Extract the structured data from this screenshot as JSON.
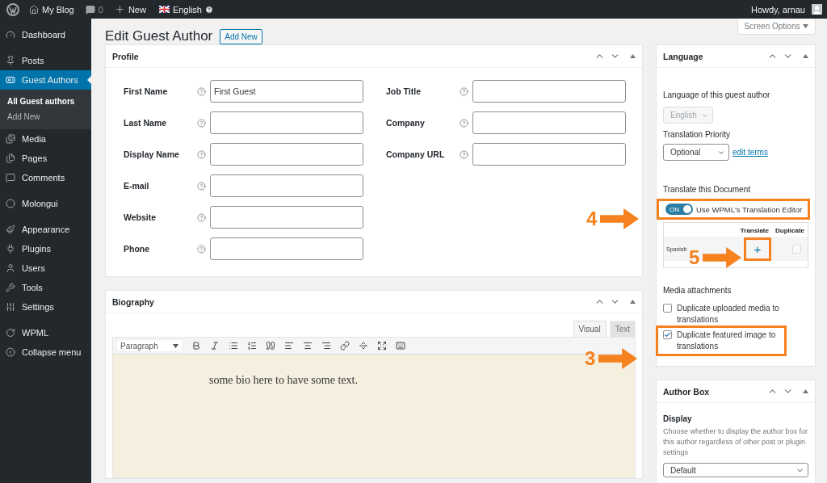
{
  "admin_bar": {
    "site": "My Blog",
    "comments": "0",
    "new": "New",
    "language": "English",
    "greeting": "Howdy, arnau"
  },
  "sidebar": {
    "groups": [
      [
        {
          "label": "Dashboard",
          "selected": false
        }
      ],
      [
        {
          "label": "Posts",
          "selected": false
        },
        {
          "label": "Guest Authors",
          "selected": true,
          "children": [
            {
              "label": "All Guest authors",
              "selected": true
            },
            {
              "label": "Add New",
              "selected": false
            }
          ]
        },
        {
          "label": "Media",
          "selected": false
        },
        {
          "label": "Pages",
          "selected": false
        },
        {
          "label": "Comments",
          "selected": false
        }
      ],
      [
        {
          "label": "Molongui",
          "selected": false
        }
      ],
      [
        {
          "label": "Appearance",
          "selected": false
        },
        {
          "label": "Plugins",
          "selected": false
        },
        {
          "label": "Users",
          "selected": false
        },
        {
          "label": "Tools",
          "selected": false
        },
        {
          "label": "Settings",
          "selected": false
        }
      ],
      [
        {
          "label": "WPML",
          "selected": false
        },
        {
          "label": "Collapse menu",
          "selected": false
        }
      ]
    ]
  },
  "screen_options": "Screen Options",
  "page_title": "Edit Guest Author",
  "add_new": "Add New",
  "profile": {
    "title": "Profile",
    "columns": [
      [
        {
          "label": "First Name",
          "value": "First Guest"
        },
        {
          "label": "Last Name"
        },
        {
          "label": "Display Name"
        },
        {
          "label": "E-mail"
        },
        {
          "label": "Website"
        },
        {
          "label": "Phone"
        }
      ],
      [
        {
          "label": "Job Title"
        },
        {
          "label": "Company"
        },
        {
          "label": "Company URL"
        }
      ]
    ]
  },
  "biography": {
    "title": "Biography",
    "tabs": [
      {
        "label": "Visual",
        "selected": true
      },
      {
        "label": "Text",
        "selected": false
      }
    ],
    "format": "Paragraph",
    "content": "some bio here to have some text."
  },
  "language_box": {
    "title": "Language",
    "language_label": "Language of this guest author",
    "language": "English",
    "priority_label": "Translation Priority",
    "priority": "Optional",
    "edit_terms": "edit terms",
    "translate_label": "Translate this Document",
    "toggle": {
      "on": true,
      "text": "ON",
      "label": "Use WPML's Translation Editor",
      "highlighted": true
    },
    "table": {
      "columns": [
        "Translate",
        "Duplicate"
      ],
      "rows": [
        {
          "language": "Spanish",
          "translate": "+",
          "translate_highlighted": true,
          "duplicate": false
        }
      ]
    },
    "media_label": "Media attachments",
    "options": [
      {
        "label": "Duplicate uploaded media to translations",
        "checked": false,
        "highlighted": false
      },
      {
        "label": "Duplicate featured image to translations",
        "checked": true,
        "highlighted": true
      }
    ]
  },
  "author_box": {
    "title": "Author Box",
    "display_label": "Display",
    "help": "Choose whether to display the author box for this author regardless of other post or plugin settings",
    "select": "Default"
  },
  "annotations": [
    {
      "number": "4"
    },
    {
      "number": "5"
    },
    {
      "number": "3"
    }
  ]
}
